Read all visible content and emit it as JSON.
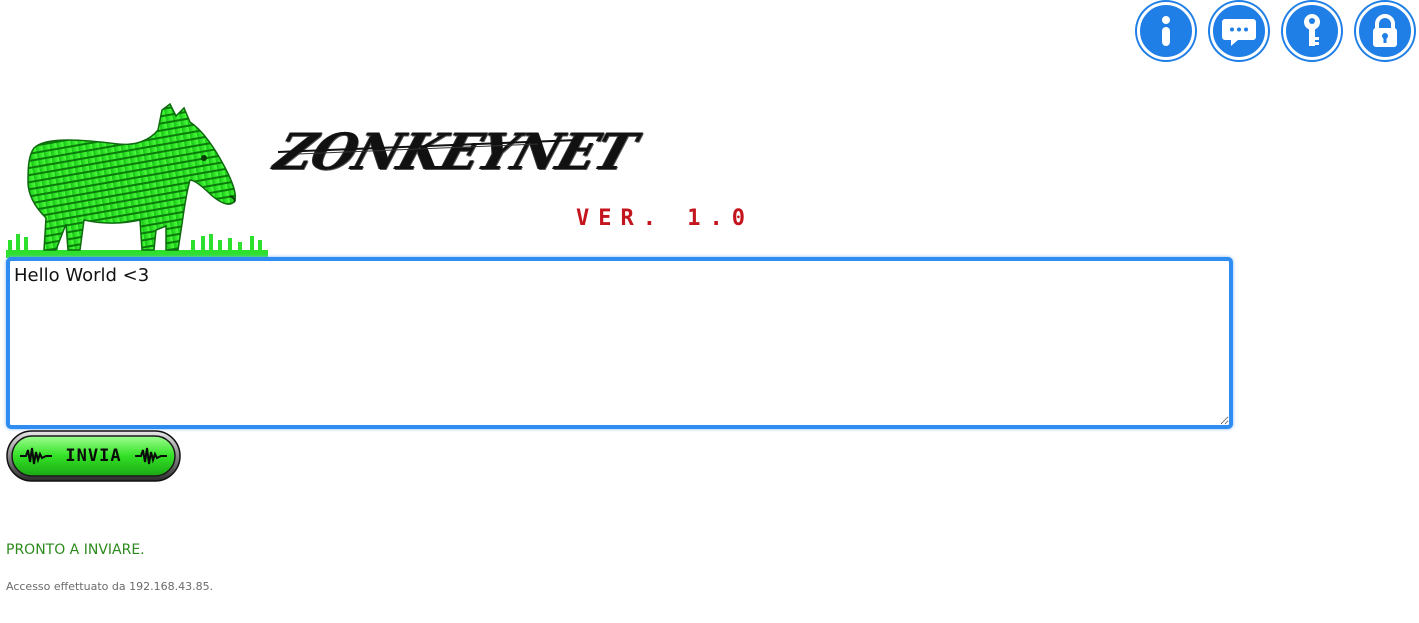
{
  "header": {
    "icons": [
      {
        "name": "info-icon"
      },
      {
        "name": "chat-icon"
      },
      {
        "name": "key-icon"
      },
      {
        "name": "lock-icon"
      }
    ]
  },
  "brand": {
    "title": "ZONKEYNET",
    "version": "VER. 1.0"
  },
  "composer": {
    "message": "Hello World <3",
    "send_label": "INVIA"
  },
  "status": {
    "message": "PRONTO A INVIARE.",
    "access": "Accesso effettuato da 192.168.43.85."
  },
  "colors": {
    "accent": "#1f7fe6",
    "status": "#2d8a1d",
    "version": "#c4141e",
    "button_green": "#3ce83c"
  }
}
